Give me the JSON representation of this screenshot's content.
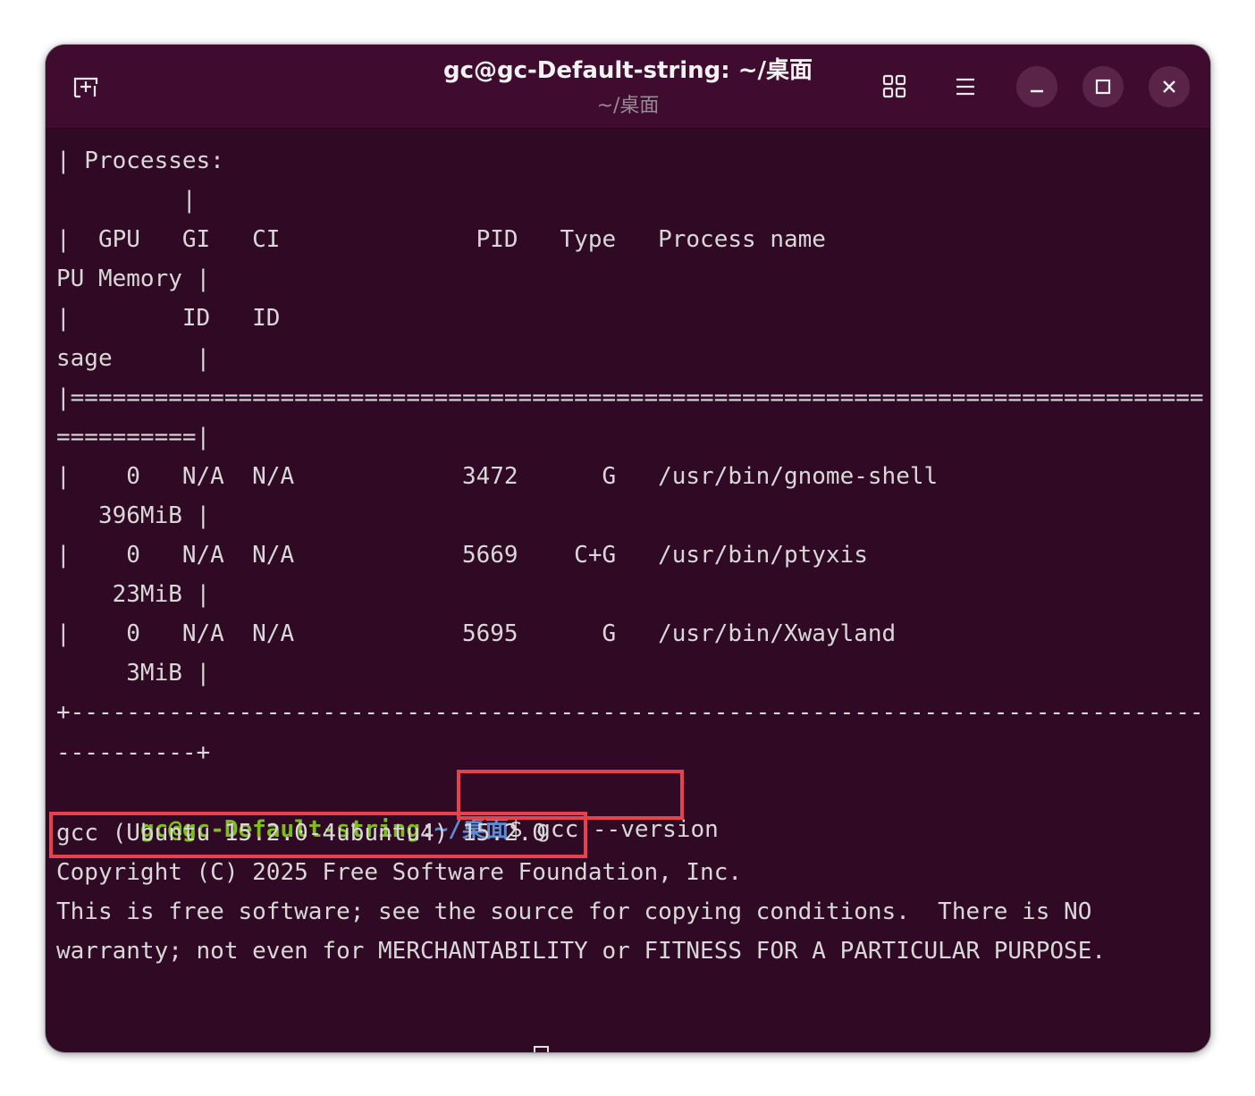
{
  "window": {
    "title": "gc@gc-Default-string: ~/桌面",
    "subtitle": "~/桌面"
  },
  "toolbar": {
    "new_tab_icon": "new-tab-icon",
    "tab_overview_icon": "grid-icon",
    "menu_icon": "hamburger-menu-icon",
    "minimize_icon": "minimize-icon",
    "maximize_icon": "maximize-icon",
    "close_icon": "close-icon"
  },
  "colors": {
    "background": "#300a24",
    "titlebar": "#3f0c30",
    "text": "#d8d8d8",
    "prompt_user": "#7ebd1e",
    "prompt_path": "#5a8fd6",
    "highlight": "#e8414e"
  },
  "terminal": {
    "output_lines": [
      "| Processes:",
      "         |",
      "|  GPU   GI   CI              PID   Type   Process name                            G",
      "PU Memory |",
      "|        ID   ID                                                                    U",
      "sage      |",
      "|=================================================================================",
      "==========|",
      "|    0   N/A  N/A            3472      G   /usr/bin/gnome-shell",
      "   396MiB |",
      "|    0   N/A  N/A            5669    C+G   /usr/bin/ptyxis",
      "    23MiB |",
      "|    0   N/A  N/A            5695      G   /usr/bin/Xwayland",
      "     3MiB |",
      "+---------------------------------------------------------------------------------",
      "----------+"
    ],
    "prompt_user": "gc@gc-Default-string",
    "prompt_sep": ":",
    "prompt_path": "~/桌面",
    "prompt_symbol": "$",
    "command": " gcc --version",
    "result_lines": [
      "gcc (Ubuntu 15.2.0-4ubuntu4) 15.2.0",
      "Copyright (C) 2025 Free Software Foundation, Inc.",
      "This is free software; see the source for copying conditions.  There is NO",
      "warranty; not even for MERCHANTABILITY or FITNESS FOR A PARTICULAR PURPOSE.",
      ""
    ]
  }
}
